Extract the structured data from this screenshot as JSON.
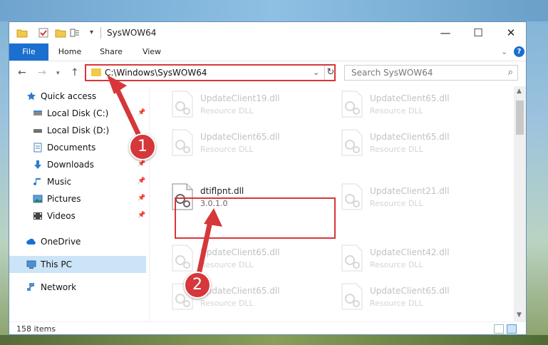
{
  "window": {
    "title": "SysWOW64",
    "minimize": "—",
    "maximize": "☐",
    "close": "✕"
  },
  "ribbon": {
    "tabs": [
      "File",
      "Home",
      "Share",
      "View"
    ],
    "help": "?"
  },
  "navigation": {
    "address": "C:\\Windows\\SysWOW64",
    "search_placeholder": "Search SysWOW64"
  },
  "sidebar": {
    "items": [
      {
        "label": "Quick access",
        "icon": "star-icon",
        "pinned": false
      },
      {
        "label": "Local Disk (C:)",
        "icon": "drive-icon",
        "pinned": true
      },
      {
        "label": "Local Disk (D:)",
        "icon": "drive-icon",
        "pinned": false
      },
      {
        "label": "Documents",
        "icon": "documents-icon",
        "pinned": true
      },
      {
        "label": "Downloads",
        "icon": "download-icon",
        "pinned": true
      },
      {
        "label": "Music",
        "icon": "music-icon",
        "pinned": true
      },
      {
        "label": "Pictures",
        "icon": "pictures-icon",
        "pinned": true
      },
      {
        "label": "Videos",
        "icon": "videos-icon",
        "pinned": true
      },
      {
        "label": "OneDrive",
        "icon": "cloud-icon",
        "pinned": false
      },
      {
        "label": "This PC",
        "icon": "computer-icon",
        "pinned": false,
        "selected": true
      },
      {
        "label": "Network",
        "icon": "network-icon",
        "pinned": false
      }
    ]
  },
  "files": [
    {
      "name": "UpdateClient19.dll",
      "sub": "Resource DLL",
      "faded": true
    },
    {
      "name": "UpdateClient65.dll",
      "sub": "Resource DLL",
      "faded": true
    },
    {
      "name": "UpdateClient65.dll",
      "sub": "Resource DLL",
      "faded": true
    },
    {
      "name": "UpdateClient65.dll",
      "sub": "Resource DLL",
      "faded": true
    },
    {
      "name": "dtiflpnt.dll",
      "sub": "3.0.1.0",
      "faded": false
    },
    {
      "name": "UpdateClient21.dll",
      "sub": "Resource DLL",
      "faded": true
    },
    {
      "name": "UpdateClient65.dll",
      "sub": "Resource DLL",
      "faded": true
    },
    {
      "name": "UpdateClient42.dll",
      "sub": "Resource DLL",
      "faded": true
    },
    {
      "name": "UpdateClient65.dll",
      "sub": "Resource DLL",
      "faded": true
    },
    {
      "name": "UpdateClient65.dll",
      "sub": "Resource DLL",
      "faded": true
    }
  ],
  "status": {
    "count": "158 items"
  },
  "callouts": [
    "1",
    "2"
  ],
  "colors": {
    "accent": "#1a6fcf",
    "highlight": "#d6373a",
    "selected": "#cce4f7"
  }
}
